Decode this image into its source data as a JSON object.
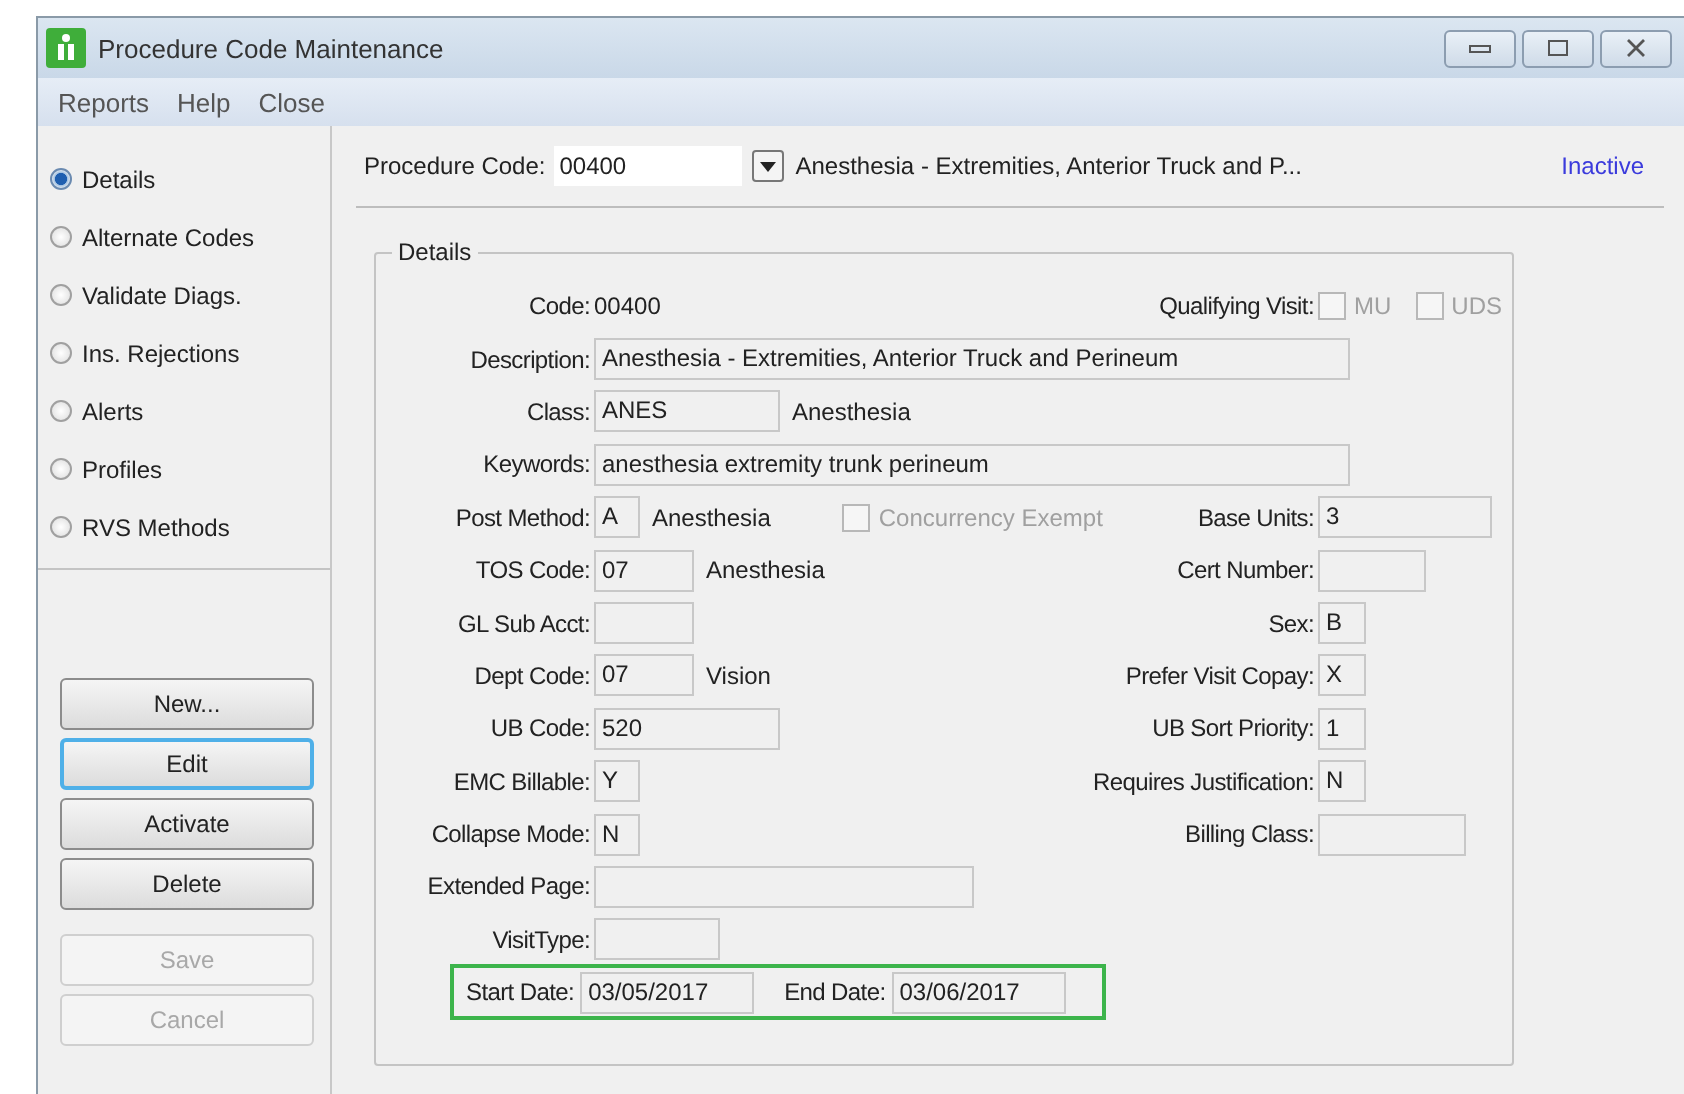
{
  "window": {
    "title": "Procedure Code Maintenance"
  },
  "menu": [
    "Reports",
    "Help",
    "Close"
  ],
  "sidebar": {
    "items": [
      {
        "label": "Details",
        "selected": true
      },
      {
        "label": "Alternate Codes",
        "selected": false
      },
      {
        "label": "Validate Diags.",
        "selected": false
      },
      {
        "label": "Ins. Rejections",
        "selected": false
      },
      {
        "label": "Alerts",
        "selected": false
      },
      {
        "label": "Profiles",
        "selected": false
      },
      {
        "label": "RVS Methods",
        "selected": false
      }
    ],
    "buttons": [
      {
        "label": "New...",
        "focused": false,
        "disabled": false
      },
      {
        "label": "Edit",
        "focused": true,
        "disabled": false
      },
      {
        "label": "Activate",
        "focused": false,
        "disabled": false
      },
      {
        "label": "Delete",
        "focused": false,
        "disabled": false
      },
      {
        "label": "Save",
        "focused": false,
        "disabled": true
      },
      {
        "label": "Cancel",
        "focused": false,
        "disabled": true
      }
    ]
  },
  "header": {
    "label": "Procedure Code:",
    "value": "00400",
    "description": "Anesthesia - Extremities, Anterior Truck and P...",
    "status": "Inactive"
  },
  "details": {
    "title": "Details",
    "rows": [
      {
        "kind": "plain",
        "label": "Code:",
        "value": "00400",
        "right": {
          "kind": "checks",
          "label": "Qualifying Visit:",
          "checks": [
            {
              "label": "MU",
              "checked": false
            },
            {
              "label": "UDS",
              "checked": false
            }
          ]
        }
      },
      {
        "kind": "field",
        "label": "Description:",
        "value": "Anesthesia - Extremities, Anterior Truck and Perineum"
      },
      {
        "kind": "field",
        "label": "Class:",
        "value": "ANES",
        "note": "Anesthesia"
      },
      {
        "kind": "field",
        "label": "Keywords:",
        "value": "anesthesia extremity trunk perineum"
      },
      {
        "kind": "field",
        "label": "Post Method:",
        "value": "A",
        "note": "Anesthesia",
        "checkbox": {
          "label": "Concurrency Exempt",
          "checked": false,
          "disabled": true
        },
        "right": {
          "kind": "field",
          "label": "Base Units:",
          "value": "3"
        }
      },
      {
        "kind": "field",
        "label": "TOS Code:",
        "value": "07",
        "note": "Anesthesia",
        "right": {
          "kind": "field",
          "label": "Cert Number:"
        }
      },
      {
        "kind": "field",
        "label": "GL Sub Acct:",
        "right": {
          "kind": "field",
          "label": "Sex:",
          "value": "B"
        }
      },
      {
        "kind": "field",
        "label": "Dept Code:",
        "value": "07",
        "note": "Vision",
        "right": {
          "kind": "field",
          "label": "Prefer Visit Copay:",
          "value": "X"
        }
      },
      {
        "kind": "field",
        "label": "UB Code:",
        "value": "520",
        "right": {
          "kind": "field",
          "label": "UB Sort Priority:",
          "value": "1"
        }
      },
      {
        "kind": "field",
        "label": "EMC Billable:",
        "value": "Y",
        "right": {
          "kind": "field",
          "label": "Requires Justification:",
          "value": "N"
        }
      },
      {
        "kind": "field",
        "label": "Collapse Mode:",
        "value": "N",
        "right": {
          "kind": "field",
          "label": "Billing Class:"
        }
      },
      {
        "kind": "field",
        "label": "Extended Page:"
      },
      {
        "kind": "field",
        "label": "VisitType:"
      },
      {
        "kind": "dates",
        "highlighted": true,
        "fields": [
          {
            "label": "Start Date:",
            "value": "03/05/2017"
          },
          {
            "label": "End Date:",
            "value": "03/06/2017"
          }
        ]
      }
    ]
  }
}
